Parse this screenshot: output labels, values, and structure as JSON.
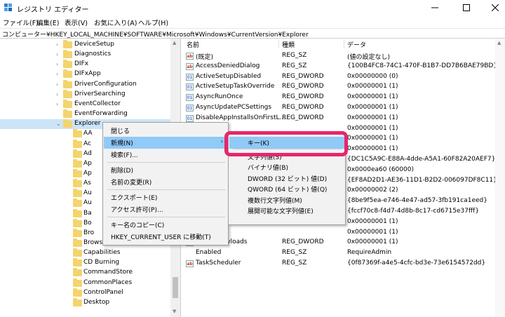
{
  "window": {
    "title": "レジストリ エディター",
    "controls": {
      "minimize": "minimize-icon",
      "maximize": "maximize-icon",
      "close": "close-icon"
    }
  },
  "menu": [
    "ファイル(F)",
    "編集(E)",
    "表示(V)",
    "お気に入り(A)",
    "ヘルプ(H)"
  ],
  "address": "コンピューター¥HKEY_LOCAL_MACHINE¥SOFTWARE¥Microsoft¥Windows¥CurrentVersion¥Explorer",
  "tree": [
    {
      "label": "DeviceSetup",
      "expandable": true
    },
    {
      "label": "Diagnostics",
      "expandable": true
    },
    {
      "label": "DIFx",
      "expandable": true
    },
    {
      "label": "DIFxApp",
      "expandable": true
    },
    {
      "label": "DriverConfiguration",
      "expandable": true
    },
    {
      "label": "DriverSearching",
      "expandable": true
    },
    {
      "label": "EventCollector",
      "expandable": true
    },
    {
      "label": "EventForwarding",
      "expandable": false
    },
    {
      "label": "Explorer",
      "expandable": true,
      "expanded": true,
      "selected": true
    },
    {
      "label": "AA",
      "child": true
    },
    {
      "label": "Ac",
      "child": true
    },
    {
      "label": "Ad",
      "child": true
    },
    {
      "label": "Ap",
      "child": true
    },
    {
      "label": "Ap",
      "child": true
    },
    {
      "label": "As",
      "child": true
    },
    {
      "label": "Au",
      "child": true
    },
    {
      "label": "Au",
      "child": true
    },
    {
      "label": "Ba",
      "child": true
    },
    {
      "label": "Bo",
      "child": true
    },
    {
      "label": "Bro",
      "child": true
    },
    {
      "label": "BrowseNewProcess",
      "child": true
    },
    {
      "label": "Capabilities",
      "child": true
    },
    {
      "label": "CD Burning",
      "child": true
    },
    {
      "label": "CommandStore",
      "child": true
    },
    {
      "label": "CommonPlaces",
      "child": true
    },
    {
      "label": "ControlPanel",
      "child": true
    },
    {
      "label": "Desktop",
      "child": true
    }
  ],
  "columns": {
    "name": "名前",
    "type": "種類",
    "data": "データ"
  },
  "values": [
    {
      "icon": "ab",
      "name": "(既定)",
      "type": "REG_SZ",
      "data": "(値の設定なし)"
    },
    {
      "icon": "ab",
      "name": "AccessDeniedDialog",
      "type": "REG_SZ",
      "data": "{100B4FC8-74C1-470F-B1B7-DD7B6BAE79BD}"
    },
    {
      "icon": "num",
      "name": "ActiveSetupDisabled",
      "type": "REG_DWORD",
      "data": "0x00000000 (0)"
    },
    {
      "icon": "num",
      "name": "ActiveSetupTaskOverride",
      "type": "REG_DWORD",
      "data": "0x00000001 (1)"
    },
    {
      "icon": "num",
      "name": "AsyncRunOnce",
      "type": "REG_DWORD",
      "data": "0x00000001 (1)"
    },
    {
      "icon": "num",
      "name": "AsyncUpdatePCSettings",
      "type": "REG_DWORD",
      "data": "0x00000001 (1)"
    },
    {
      "icon": "num",
      "name": "DisableAppInstallsOnFirstL...",
      "type": "REG_DWORD",
      "data": "0x00000001 (1)"
    },
    {
      "icon": "num",
      "name": "",
      "type": "",
      "data": "0x00000001 (1)"
    },
    {
      "icon": "",
      "name": "",
      "type": "",
      "data": "0x00000001 (1)"
    },
    {
      "icon": "",
      "name": "",
      "type": "",
      "data": "0x00000001 (1)"
    },
    {
      "icon": "",
      "name": "",
      "type": "",
      "data": "{DC1C5A9C-E88A-4dde-A5A1-60F82A20AEF7}"
    },
    {
      "icon": "",
      "name": "",
      "type": "",
      "data": "0x0000ea60 (60000)"
    },
    {
      "icon": "",
      "name": "",
      "type": "",
      "data": "{EF8AD2D1-AE36-11D1-B2D2-006097DF8C11}"
    },
    {
      "icon": "",
      "name": "",
      "type": "",
      "data": "0x00000002 (2)"
    },
    {
      "icon": "",
      "name": "",
      "type": "",
      "data": "{8be9f5ea-e746-4e47-ad57-3fb191ca1eed}"
    },
    {
      "icon": "",
      "name": "",
      "type": "",
      "data": "{fccf70c8-f4d7-4d8b-8c17-cd6715e37fff}"
    },
    {
      "icon": "",
      "name": "",
      "type": "",
      "data": "0x00000001 (1)"
    },
    {
      "icon": "",
      "name": "",
      "type": "",
      "data": "0x00000001 (1)"
    },
    {
      "icon": "num",
      "name": "oamingPayloads",
      "type": "REG_DWORD",
      "data": "0x00000001 (1)"
    },
    {
      "icon": "",
      "name": "Enabled",
      "type": "REG_SZ",
      "data": "RequireAdmin"
    },
    {
      "icon": "ab",
      "name": "TaskScheduler",
      "type": "REG_SZ",
      "data": "{0f87369f-a4e5-4cfc-bd3e-73e6154572dd}"
    }
  ],
  "context_menu": {
    "items": [
      {
        "label": "閉じる"
      },
      {
        "label": "新規(N)",
        "submenu": true,
        "highlighted": true
      },
      {
        "label": "検索(F)..."
      },
      {
        "sep": true
      },
      {
        "label": "削除(D)"
      },
      {
        "label": "名前の変更(R)"
      },
      {
        "sep": true
      },
      {
        "label": "エクスポート(E)"
      },
      {
        "label": "アクセス許可(P)..."
      },
      {
        "sep": true
      },
      {
        "label": "キー名のコピー(C)"
      },
      {
        "label": "HKEY_CURRENT_USER に移動(T)"
      }
    ]
  },
  "submenu": {
    "items": [
      {
        "label": "キー(K)",
        "highlighted": true
      },
      {
        "sep": true
      },
      {
        "label": "文字列値(S)"
      },
      {
        "label": "バイナリ値(B)"
      },
      {
        "label": "DWORD (32 ビット) 値(D)"
      },
      {
        "label": "QWORD (64 ビット) 値(Q)"
      },
      {
        "label": "複数行文字列値(M)"
      },
      {
        "label": "展開可能な文字列値(E)"
      }
    ]
  },
  "accent": "#e6266c",
  "menu_highlight": "#91c9f7"
}
